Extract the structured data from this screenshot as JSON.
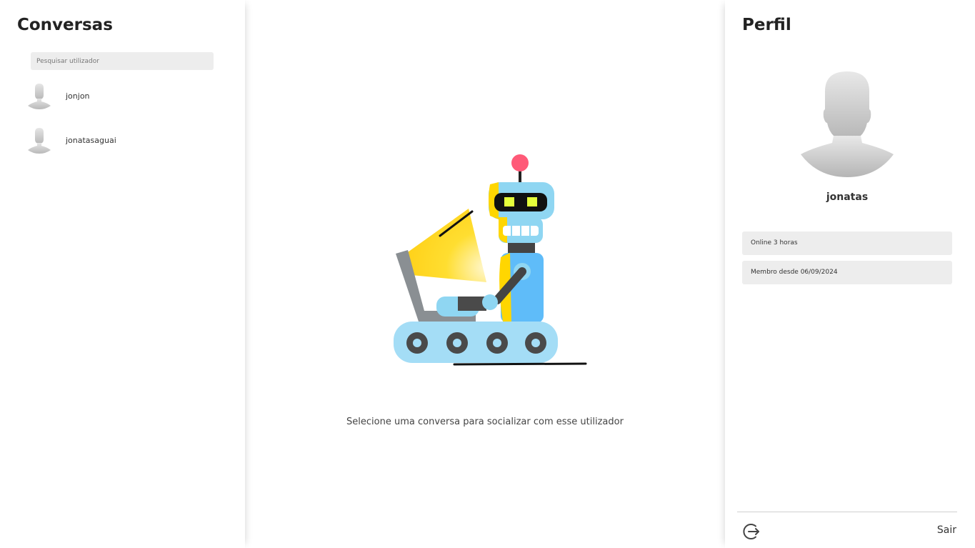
{
  "sidebar": {
    "title": "Conversas",
    "search": {
      "placeholder": "Pesquisar utilizador",
      "value": ""
    },
    "users": [
      {
        "name": "jonjon"
      },
      {
        "name": "jonatasaguai"
      }
    ]
  },
  "main": {
    "empty_message": "Selecione uma conversa para socializar com esse utilizador",
    "illustration": "robot-illustration"
  },
  "profile": {
    "title": "Perfil",
    "username": "jonatas",
    "online_status": "Online 3 horas",
    "member_since": "Membro desde 06/09/2024",
    "logout_label": "Sair"
  },
  "icons": {
    "avatar": "user-silhouette-icon",
    "logout": "logout-icon"
  },
  "colors": {
    "panel_background": "#ffffff",
    "input_background": "#ededed",
    "avatar_gray": "#c4c4c4"
  }
}
